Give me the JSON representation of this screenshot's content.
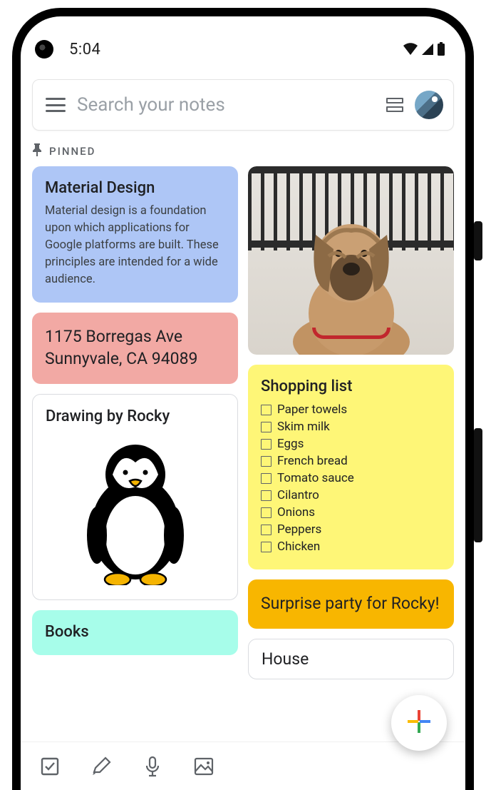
{
  "status": {
    "time": "5:04"
  },
  "search": {
    "placeholder": "Search your notes"
  },
  "section": {
    "pinned_label": "PINNED"
  },
  "notes": {
    "material": {
      "title": "Material Design",
      "body": "Material design is a foundation upon which applications for Google platforms are built. These principles are intended for a wide audience.",
      "color": "#aec6f6"
    },
    "address": {
      "body": "1175 Borregas Ave Sunnyvale, CA 94089",
      "color": "#f2a9a4"
    },
    "drawing": {
      "title": "Drawing by Rocky"
    },
    "books": {
      "title": "Books",
      "color": "#a7fdea"
    },
    "shopping": {
      "title": "Shopping list",
      "items": [
        "Paper towels",
        "Skim milk",
        "Eggs",
        "French bread",
        "Tomato sauce",
        "Cilantro",
        "Onions",
        "Peppers",
        "Chicken"
      ],
      "color": "#fef677"
    },
    "surprise": {
      "title": "Surprise party for Rocky!",
      "color": "#f8b600"
    },
    "house": {
      "title": "House",
      "color": "#ffffff"
    }
  }
}
